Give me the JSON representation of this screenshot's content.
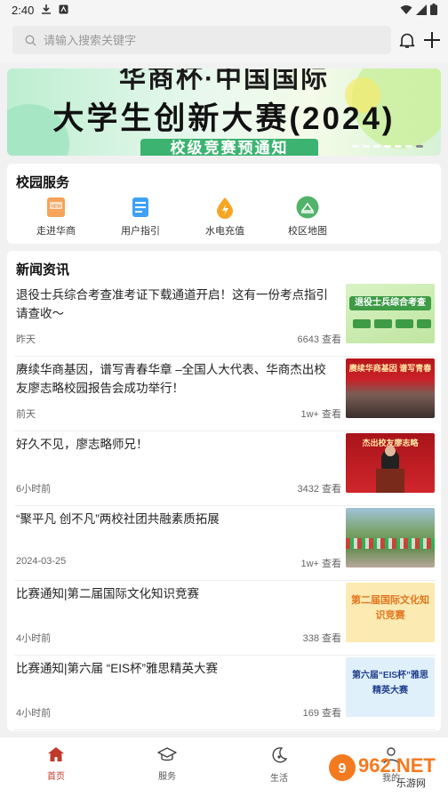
{
  "status": {
    "time": "2:40"
  },
  "search": {
    "placeholder": "请输入搜索关键字"
  },
  "banner": {
    "line1": "华商杯·中国国际",
    "line2": "大学生创新大赛(2024)",
    "line3": "校级竞赛预通知"
  },
  "services": {
    "title": "校园服务",
    "items": [
      {
        "label": "走进华商",
        "icon": "brochure-icon",
        "color": "#f2994a"
      },
      {
        "label": "用户指引",
        "icon": "guide-doc-icon",
        "color": "#3fa1f5"
      },
      {
        "label": "水电充值",
        "icon": "utility-drop-icon",
        "color": "#f5a623"
      },
      {
        "label": "校区地图",
        "icon": "map-icon",
        "color": "#52b36a"
      }
    ]
  },
  "news": {
    "title": "新闻资讯",
    "items": [
      {
        "title": "退役士兵综合考查准考证下载通道开启！这有一份考点指引请查收～",
        "date": "昨天",
        "views": "6643 查看",
        "thumb_text": "退役士兵综合考查"
      },
      {
        "title": "赓续华商基因，谱写青春华章 –全国人大代表、华商杰出校友廖志略校园报告会成功举行！",
        "date": "前天",
        "views": "1w+ 查看",
        "thumb_text": "赓续华商基因 谱写青春"
      },
      {
        "title": "好久不见，廖志略师兄！",
        "date": "6小时前",
        "views": "3432 查看",
        "thumb_text": "杰出校友廖志略"
      },
      {
        "title": "“聚平凡 创不凡”两校社团共融素质拓展",
        "date": "2024-03-25",
        "views": "1w+ 查看",
        "thumb_text": ""
      },
      {
        "title": "比赛通知|第二届国际文化知识竞赛",
        "date": "4小时前",
        "views": "338 查看",
        "thumb_text": "第二届国际文化知识竞赛"
      },
      {
        "title": "比赛通知|第六届 “EIS杯”雅思精英大赛",
        "date": "4小时前",
        "views": "169 查看",
        "thumb_text": "第六届“EIS杯”雅思精英大赛"
      }
    ]
  },
  "tabbar": {
    "items": [
      {
        "label": "首页",
        "icon": "home-icon",
        "active": true
      },
      {
        "label": "服务",
        "icon": "graduation-cap-icon",
        "active": false
      },
      {
        "label": "生活",
        "icon": "moon-icon",
        "active": false
      },
      {
        "label": "我的",
        "icon": "user-icon",
        "active": false
      }
    ]
  },
  "watermark": {
    "brand": "962.NET",
    "sub": "乐游网"
  },
  "colors": {
    "accent": "#c0392b",
    "banner_green": "#3cb371"
  }
}
